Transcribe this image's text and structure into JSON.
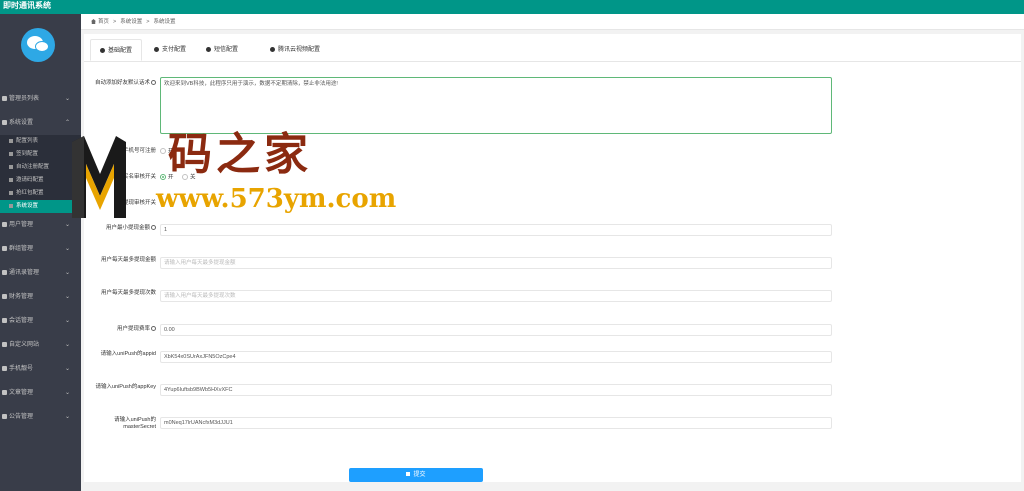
{
  "app": {
    "title": "即时通讯系统"
  },
  "sidebar": {
    "items": [
      {
        "label": "管理员列表",
        "expanded": false
      },
      {
        "label": "系统设置",
        "expanded": true,
        "children": [
          "配置列表",
          "签到配置",
          "自动注册配置",
          "邀请码配置",
          "抢红包配置",
          "系统设置"
        ]
      },
      {
        "label": "用户管理",
        "expanded": false
      },
      {
        "label": "群组管理",
        "expanded": false
      },
      {
        "label": "通讯录管理",
        "expanded": false
      },
      {
        "label": "财务管理",
        "expanded": false
      },
      {
        "label": "会话管理",
        "expanded": false
      },
      {
        "label": "自定义网站",
        "expanded": false
      },
      {
        "label": "手机靓号",
        "expanded": false
      },
      {
        "label": "文章管理",
        "expanded": false
      },
      {
        "label": "公告管理",
        "expanded": false
      }
    ],
    "active_child": "系统设置"
  },
  "breadcrumb": [
    "首页",
    "系统设置",
    "系统设置"
  ],
  "tabs": [
    "基础配置",
    "支付配置",
    "短信配置",
    "腾讯云视频配置"
  ],
  "active_tab": "基础配置",
  "form": {
    "welcome": {
      "label": "自动添加好友默认话术",
      "value": "欢迎来到VB科技，此程序只用于演示，数据不定期清除，禁止非法用途!"
    },
    "radio1": {
      "label": "手机号可注册",
      "options": [
        "开",
        "关"
      ]
    },
    "radio2": {
      "label": "实名审核开关",
      "options": [
        "开",
        "关"
      ],
      "selected": "开"
    },
    "radio3": {
      "label": "提现审核开关"
    },
    "min_withdraw": {
      "label": "用户最小提现金额",
      "value": "1"
    },
    "daily_amount": {
      "label": "用户每天最多提现金额",
      "placeholder": "请输入用户每天最多提现金额"
    },
    "daily_count": {
      "label": "用户每天最多提现次数",
      "placeholder": "请输入用户每天最多提现次数"
    },
    "fee_rate": {
      "label": "用户提现费率",
      "value": "0.00"
    },
    "unipush_appid": {
      "label": "请输入uniPush的appid",
      "value": "XbK54x0SUrAxJFN5OzCpe4"
    },
    "unipush_appkey": {
      "label": "请输入uniPush的appKey",
      "value": "4Yup6Iuftsb9BWb5HXvXFC"
    },
    "unipush_secret": {
      "label": "请输入uniPush的masterSecret",
      "value": "m0Neq17lrUANcfxM3dJJU1"
    },
    "submit_label": "提交"
  },
  "watermark": {
    "brand": "码之家",
    "url": "www.573ym.com"
  },
  "colors": {
    "topbar": "#009688",
    "sidebar": "#393d49",
    "active": "#009688",
    "button": "#1e9fff"
  }
}
